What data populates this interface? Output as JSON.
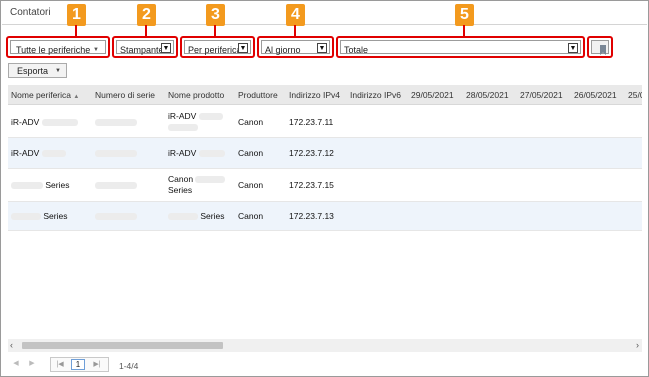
{
  "window": {
    "title": "Contatori"
  },
  "toolbar": {
    "device_filter": "Tutte le periferiche",
    "device_type": "Stampante",
    "grouping": "Per periferica",
    "period": "Al giorno",
    "counter": "Totale",
    "export_label": "Esporta"
  },
  "badges": [
    "1",
    "2",
    "3",
    "4",
    "5"
  ],
  "table": {
    "headers": [
      "Nome periferica",
      "Numero di serie",
      "Nome prodotto",
      "Produttore",
      "Indirizzo IPv4",
      "Indirizzo IPv6",
      "29/05/2021",
      "28/05/2021",
      "27/05/2021",
      "26/05/2021",
      "25/05"
    ],
    "sort_indicator": "▲",
    "rows": [
      {
        "name": "iR-ADV",
        "product_line1": "iR-ADV",
        "product_line2": "",
        "manufacturer": "Canon",
        "ipv4": "172.23.7.11"
      },
      {
        "name": "iR-ADV",
        "product_line1": "iR-ADV",
        "product_line2": "",
        "manufacturer": "Canon",
        "ipv4": "172.23.7.12"
      },
      {
        "name": "Series",
        "product_line1": "Canon",
        "product_line2": "Series",
        "manufacturer": "Canon",
        "ipv4": "172.23.7.15"
      },
      {
        "name": "Series",
        "product_line1": "Series",
        "product_line2": "",
        "manufacturer": "Canon",
        "ipv4": "172.23.7.13"
      }
    ]
  },
  "pager": {
    "current_page": "1",
    "info": "1-4/4"
  },
  "colors": {
    "highlight": "#e00000",
    "badge": "#f39a1e",
    "row_alt": "#eef4fb"
  }
}
